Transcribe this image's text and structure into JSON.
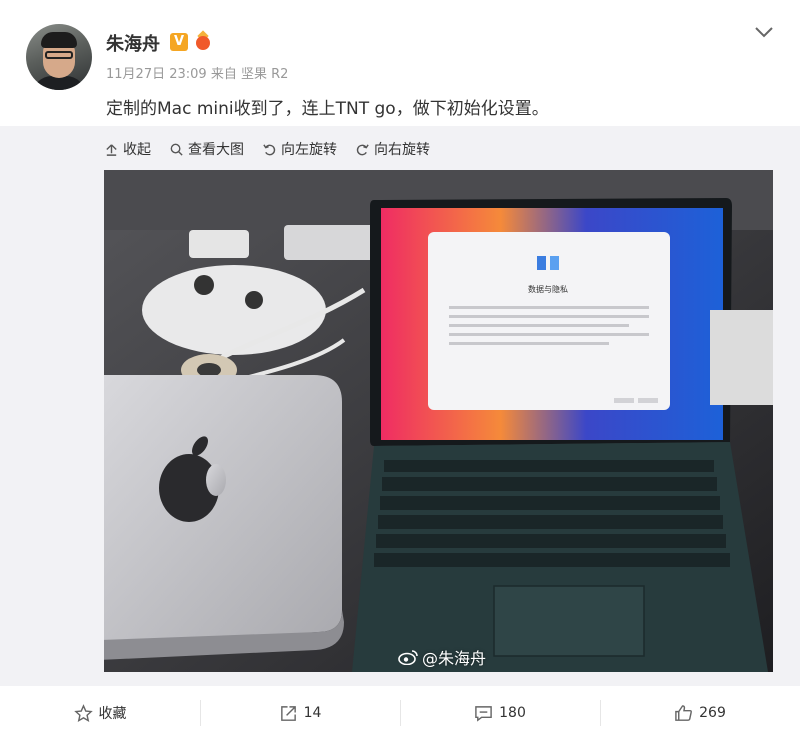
{
  "post": {
    "username": "朱海舟",
    "verified_badge": "V",
    "meta": "11月27日 23:09 来自 坚果 R2",
    "text": "定制的Mac mini收到了，连上TNT go，做下初始化设置。"
  },
  "toolbar": {
    "collapse": "收起",
    "view_large": "查看大图",
    "rotate_left": "向左旋转",
    "rotate_right": "向右旋转"
  },
  "photo": {
    "watermark": "@朱海舟",
    "screen_title": "数据与隐私"
  },
  "actions": {
    "favorite": "收藏",
    "repost": "14",
    "comment": "180",
    "like": "269"
  },
  "colors": {
    "accent_orange": "#f5a623",
    "text": "#333333",
    "muted": "#999999"
  }
}
